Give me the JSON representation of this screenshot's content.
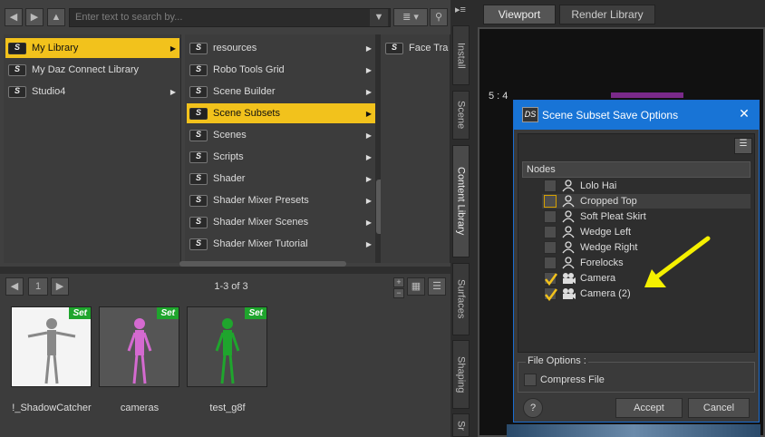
{
  "left_panel": {
    "search_placeholder": "Enter text to search by...",
    "column1": [
      {
        "label": "My Library",
        "selected": true,
        "has_children": true
      },
      {
        "label": "My Daz Connect Library",
        "selected": false,
        "has_children": false
      },
      {
        "label": "Studio4",
        "selected": false,
        "has_children": true
      }
    ],
    "column2": [
      {
        "label": "resources",
        "selected": false
      },
      {
        "label": "Robo Tools Grid",
        "selected": false
      },
      {
        "label": "Scene Builder",
        "selected": false
      },
      {
        "label": "Scene Subsets",
        "selected": true
      },
      {
        "label": "Scenes",
        "selected": false
      },
      {
        "label": "Scripts",
        "selected": false
      },
      {
        "label": "Shader",
        "selected": false
      },
      {
        "label": "Shader Mixer Presets",
        "selected": false
      },
      {
        "label": "Shader Mixer Scenes",
        "selected": false
      },
      {
        "label": "Shader Mixer Tutorial",
        "selected": false
      }
    ],
    "column3": [
      {
        "label": "Face Tra"
      }
    ],
    "page_number": "1",
    "result_count": "1-3 of 3",
    "thumbnails": [
      {
        "label": "!_ShadowCatcher",
        "badge": "Set"
      },
      {
        "label": "cameras",
        "badge": "Set"
      },
      {
        "label": "test_g8f",
        "badge": "Set"
      }
    ]
  },
  "side_tabs": [
    "Install",
    "Scene",
    "Content Library",
    "Surfaces",
    "Shaping",
    "Sr"
  ],
  "right_panel": {
    "tabs": [
      "Viewport",
      "Render Library"
    ],
    "ratio_label": "5 : 4"
  },
  "dialog": {
    "icon_text": "DS",
    "title": "Scene Subset Save Options",
    "close": "✕",
    "nodes_header": "Nodes",
    "nodes": [
      {
        "label": "Lolo Hai",
        "checked": false,
        "type": "figure"
      },
      {
        "label": "Cropped Top",
        "checked": false,
        "type": "figure",
        "highlighted": true
      },
      {
        "label": "Soft Pleat Skirt",
        "checked": false,
        "type": "figure"
      },
      {
        "label": "Wedge Left",
        "checked": false,
        "type": "figure"
      },
      {
        "label": "Wedge Right",
        "checked": false,
        "type": "figure"
      },
      {
        "label": "Forelocks",
        "checked": false,
        "type": "figure"
      },
      {
        "label": "Camera",
        "checked": true,
        "type": "camera"
      },
      {
        "label": "Camera (2)",
        "checked": true,
        "type": "camera"
      }
    ],
    "file_options_label": "File Options :",
    "compress_label": "Compress File",
    "help": "?",
    "accept": "Accept",
    "cancel": "Cancel"
  },
  "colors": {
    "selection": "#f2c21c",
    "dialog_title": "#1874d6",
    "set_badge": "#1fa52d",
    "annotation_arrow": "#f5f000"
  }
}
